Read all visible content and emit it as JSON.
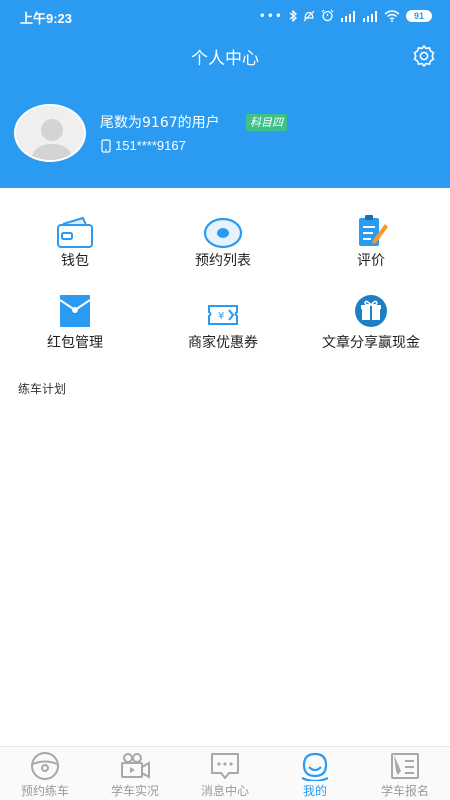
{
  "status_bar": {
    "time": "上午9:23",
    "dots": "•••",
    "battery": "91"
  },
  "header": {
    "title": "个人中心"
  },
  "user": {
    "name": "尾数为9167的用户",
    "subject_badge": "科目四",
    "phone": "151****9167"
  },
  "menu": {
    "items": [
      {
        "label": "钱包",
        "icon": "wallet-icon"
      },
      {
        "label": "预约列表",
        "icon": "appointment-list-icon"
      },
      {
        "label": "评价",
        "icon": "review-icon"
      },
      {
        "label": "红包管理",
        "icon": "red-envelope-icon"
      },
      {
        "label": "商家优惠券",
        "icon": "coupon-icon"
      },
      {
        "label": "文章分享赢现金",
        "icon": "gift-icon"
      }
    ]
  },
  "section": {
    "title": "练车计划"
  },
  "tabbar": {
    "tabs": [
      {
        "label": "预约练车",
        "icon": "steering-wheel-icon",
        "active": false
      },
      {
        "label": "学车实况",
        "icon": "video-camera-icon",
        "active": false
      },
      {
        "label": "消息中心",
        "icon": "message-icon",
        "active": false
      },
      {
        "label": "我的",
        "icon": "smile-icon",
        "active": true
      },
      {
        "label": "学车报名",
        "icon": "signup-icon",
        "active": false
      }
    ]
  },
  "colors": {
    "primary": "#2a9bf0",
    "badge": "#3fc08a",
    "inactive": "#9a9a9a"
  }
}
